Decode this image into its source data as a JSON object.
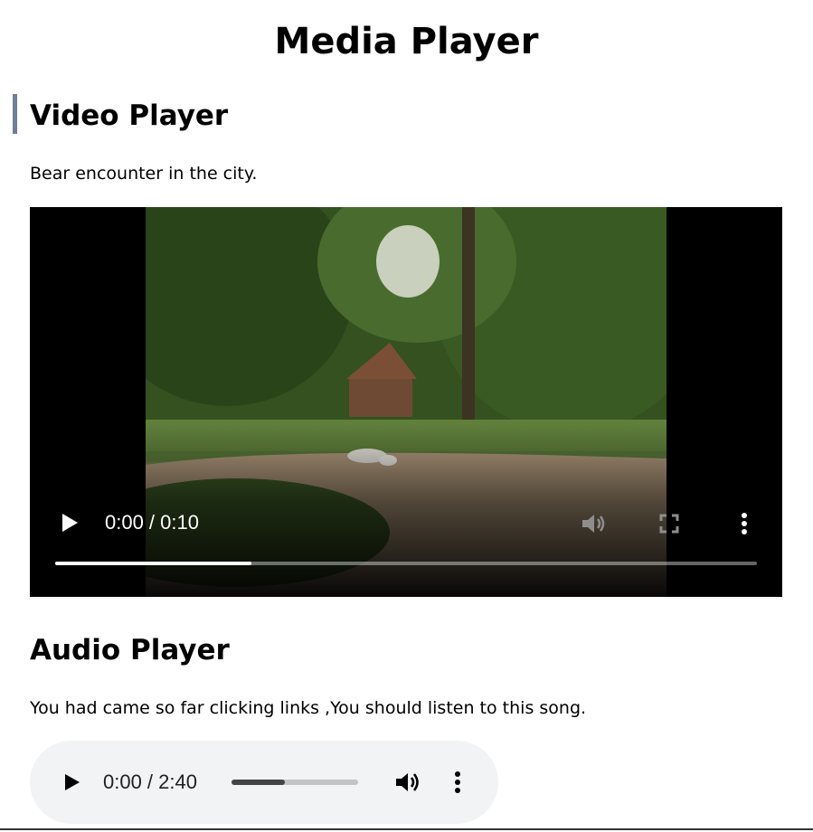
{
  "page": {
    "title": "Media Player"
  },
  "video_section": {
    "heading": "Video Player",
    "description": "Bear encounter in the city.",
    "player": {
      "time": "0:00 / 0:10",
      "progress_fraction": 0.28,
      "icons": {
        "play": "play-icon",
        "volume": "volume-icon",
        "fullscreen": "fullscreen-icon",
        "more": "more-vertical-icon"
      }
    }
  },
  "audio_section": {
    "heading": "Audio Player",
    "description": "You had came so far clicking links ,You should listen to this song.",
    "player": {
      "time": "0:00 / 2:40",
      "progress_fraction": 0.42,
      "icons": {
        "play": "play-icon",
        "volume": "volume-icon",
        "more": "more-vertical-icon"
      }
    }
  },
  "colors": {
    "section_accent_bar": "#6f7f96",
    "audio_player_bg": "#f1f3f4"
  }
}
